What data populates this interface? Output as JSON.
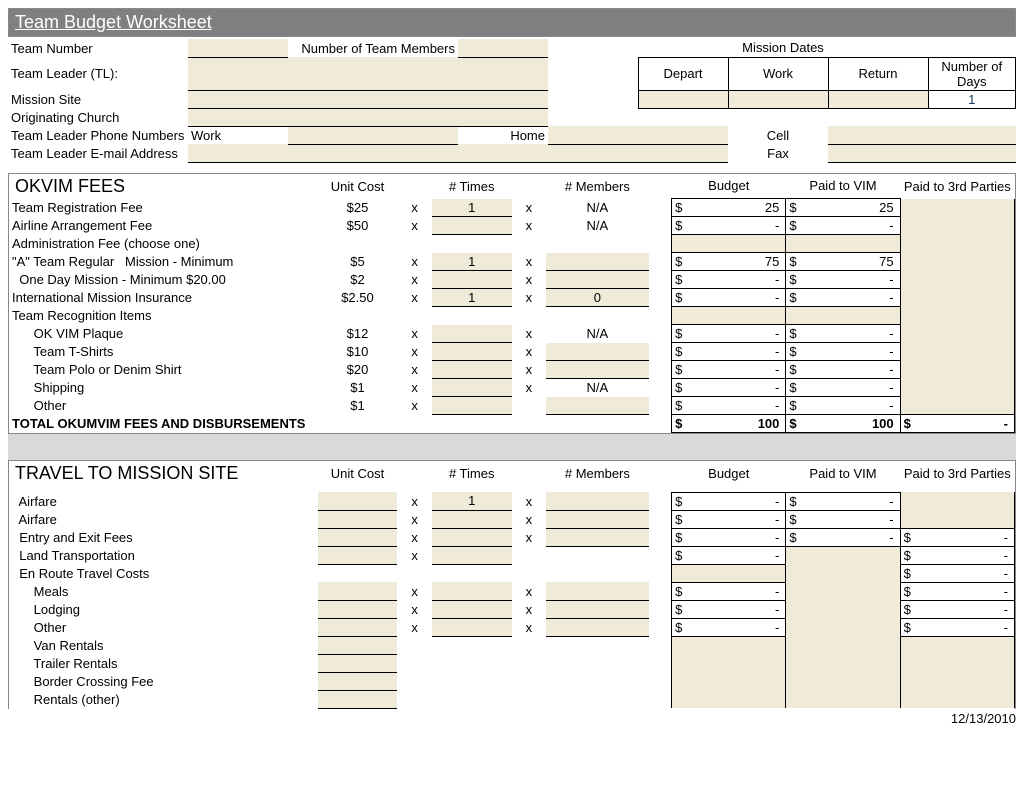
{
  "title": "Team Budget Worksheet",
  "header": {
    "teamNumberLabel": "Team Number",
    "numMembersLabel": "Number of Team Members",
    "missionDatesLabel": "Mission   Dates",
    "teamLeaderLabel": "Team Leader (TL):",
    "departLabel": "Depart",
    "workLabel": "Work",
    "returnLabel": "Return",
    "numDaysLabel": "Number of Days",
    "missionSiteLabel": "Mission Site",
    "numDaysValue": "1",
    "origChurchLabel": "Originating Church",
    "phoneLabel": "Team Leader Phone Numbers",
    "workPhoneLabel": "Work",
    "homePhoneLabel": "Home",
    "cellPhoneLabel": "Cell",
    "emailLabel": "Team Leader E-mail Address",
    "faxLabel": "Fax"
  },
  "cols": {
    "unitCost": "Unit Cost",
    "times": "# Times",
    "members": "# Members",
    "budget": "Budget",
    "paidVIM": "Paid to VIM",
    "paid3rd": "Paid to 3rd Parties"
  },
  "fees": {
    "title": "OKVIM FEES",
    "rows": [
      {
        "label": "Team Registration Fee",
        "cost": "$25",
        "x1": "x",
        "times": "1",
        "x2": "x",
        "members": "N/A",
        "b": "25",
        "v": "25",
        "p": null,
        "inTimes": true,
        "showB": true,
        "showV": true,
        "showP": false
      },
      {
        "label": "Airline Arrangement Fee",
        "cost": "$50",
        "x1": "x",
        "times": "",
        "x2": "x",
        "members": "N/A",
        "b": "-",
        "v": "-",
        "p": null,
        "inTimes": true,
        "showB": true,
        "showV": true,
        "showP": false
      },
      {
        "label": "Administration Fee (choose one)",
        "cost": "",
        "x1": "",
        "times": "",
        "x2": "",
        "members": "",
        "b": null,
        "v": null,
        "p": null,
        "inTimes": false,
        "showB": false,
        "showV": false,
        "showP": false
      },
      {
        "label": "\"A\" Team Regular   Mission - Minimum",
        "cost": "$5",
        "x1": "x",
        "times": "1",
        "x2": "x",
        "members": "",
        "b": "75",
        "v": "75",
        "p": null,
        "inTimes": true,
        "inMembers": true,
        "showB": true,
        "showV": true,
        "showP": false
      },
      {
        "label": "  One Day Mission - Minimum $20.00",
        "cost": "$2",
        "x1": "x",
        "times": "",
        "x2": "x",
        "members": "",
        "b": "-",
        "v": "-",
        "p": null,
        "inTimes": true,
        "inMembers": true,
        "showB": true,
        "showV": true,
        "showP": false
      },
      {
        "label": "International Mission Insurance",
        "cost": "$2.50",
        "x1": "x",
        "times": "1",
        "x2": "x",
        "members": "0",
        "b": "-",
        "v": "-",
        "p": null,
        "inTimes": true,
        "inMembers": true,
        "showB": true,
        "showV": true,
        "showP": false
      },
      {
        "label": "Team Recognition Items",
        "cost": "",
        "x1": "",
        "times": "",
        "x2": "",
        "members": "",
        "b": null,
        "v": null,
        "p": null,
        "inTimes": false,
        "showB": false,
        "showV": false,
        "showP": false
      },
      {
        "label": "      OK VIM Plaque",
        "cost": "$12",
        "x1": "x",
        "times": "",
        "x2": "x",
        "members": "N/A",
        "b": "-",
        "v": "-",
        "p": null,
        "inTimes": true,
        "showB": true,
        "showV": true,
        "showP": false
      },
      {
        "label": "      Team T-Shirts",
        "cost": "$10",
        "x1": "x",
        "times": "",
        "x2": "x",
        "members": "",
        "b": "-",
        "v": "-",
        "p": null,
        "inTimes": true,
        "inMembers": true,
        "showB": true,
        "showV": true,
        "showP": false
      },
      {
        "label": "      Team Polo or Denim Shirt",
        "cost": "$20",
        "x1": "x",
        "times": "",
        "x2": "x",
        "members": "",
        "b": "-",
        "v": "-",
        "p": null,
        "inTimes": true,
        "inMembers": true,
        "showB": true,
        "showV": true,
        "showP": false
      },
      {
        "label": "      Shipping",
        "cost": "$1",
        "x1": "x",
        "times": "",
        "x2": "x",
        "members": "N/A",
        "b": "-",
        "v": "-",
        "p": null,
        "inTimes": true,
        "showB": true,
        "showV": true,
        "showP": false
      },
      {
        "label": "      Other",
        "cost": "$1",
        "x1": "x",
        "times": "",
        "x2": "",
        "members": "",
        "b": "-",
        "v": "-",
        "p": null,
        "inTimes": true,
        "inMembers": true,
        "showB": true,
        "showV": true,
        "showP": false
      }
    ],
    "totalLabel": "TOTAL OKUMVIM FEES AND DISBURSEMENTS",
    "totalB": "100",
    "totalV": "100",
    "totalP": "-"
  },
  "travel": {
    "title": "TRAVEL TO MISSION SITE",
    "rows": [
      {
        "label": "  Airfare",
        "cost": "",
        "x1": "x",
        "times": "1",
        "x2": "x",
        "members": "",
        "b": "-",
        "v": "-",
        "p": null,
        "inCost": true,
        "inTimes": true,
        "inMembers": true,
        "showB": true,
        "showV": true,
        "showP": false
      },
      {
        "label": "  Airfare",
        "cost": "",
        "x1": "x",
        "times": "",
        "x2": "x",
        "members": "",
        "b": "-",
        "v": "-",
        "p": null,
        "inCost": true,
        "inTimes": true,
        "inMembers": true,
        "showB": true,
        "showV": true,
        "showP": false
      },
      {
        "label": "  Entry and Exit Fees",
        "cost": "",
        "x1": "x",
        "times": "",
        "x2": "x",
        "members": "",
        "b": "-",
        "v": "-",
        "p": "-",
        "inCost": true,
        "inTimes": true,
        "inMembers": true,
        "showB": true,
        "showV": true,
        "showP": true
      },
      {
        "label": "  Land Transportation",
        "cost": "",
        "x1": "x",
        "times": "",
        "x2": "",
        "members": "",
        "b": "-",
        "v": null,
        "p": "-",
        "inCost": true,
        "inTimes": true,
        "showB": true,
        "showV": false,
        "showP": true
      },
      {
        "label": "  En Route Travel Costs",
        "cost": "",
        "x1": "",
        "times": "",
        "x2": "",
        "members": "",
        "b": null,
        "v": null,
        "p": "-",
        "showB": false,
        "showV": false,
        "showP": true
      },
      {
        "label": "      Meals",
        "cost": "",
        "x1": "x",
        "times": "",
        "x2": "x",
        "members": "",
        "b": "-",
        "v": null,
        "p": "-",
        "inCost": true,
        "inTimes": true,
        "inMembers": true,
        "showB": true,
        "showV": false,
        "showP": true
      },
      {
        "label": "      Lodging",
        "cost": "",
        "x1": "x",
        "times": "",
        "x2": "x",
        "members": "",
        "b": "-",
        "v": null,
        "p": "-",
        "inCost": true,
        "inTimes": true,
        "inMembers": true,
        "showB": true,
        "showV": false,
        "showP": true
      },
      {
        "label": "      Other",
        "cost": "",
        "x1": "x",
        "times": "",
        "x2": "x",
        "members": "",
        "b": "-",
        "v": null,
        "p": "-",
        "inCost": true,
        "inTimes": true,
        "inMembers": true,
        "showB": true,
        "showV": false,
        "showP": true
      },
      {
        "label": "      Van Rentals",
        "cost": "",
        "x1": "",
        "times": "",
        "x2": "",
        "members": "",
        "b": null,
        "v": null,
        "p": null,
        "inCost": true,
        "showB": false,
        "showV": false,
        "showP": false
      },
      {
        "label": "      Trailer Rentals",
        "cost": "",
        "x1": "",
        "times": "",
        "x2": "",
        "members": "",
        "b": null,
        "v": null,
        "p": null,
        "inCost": true,
        "showB": false,
        "showV": false,
        "showP": false
      },
      {
        "label": "      Border Crossing Fee",
        "cost": "",
        "x1": "",
        "times": "",
        "x2": "",
        "members": "",
        "b": null,
        "v": null,
        "p": null,
        "inCost": true,
        "showB": false,
        "showV": false,
        "showP": false
      },
      {
        "label": "      Rentals (other)",
        "cost": "",
        "x1": "",
        "times": "",
        "x2": "",
        "members": "",
        "b": null,
        "v": null,
        "p": null,
        "inCost": true,
        "showB": false,
        "showV": false,
        "showP": false
      }
    ]
  },
  "footerDate": "12/13/2010"
}
